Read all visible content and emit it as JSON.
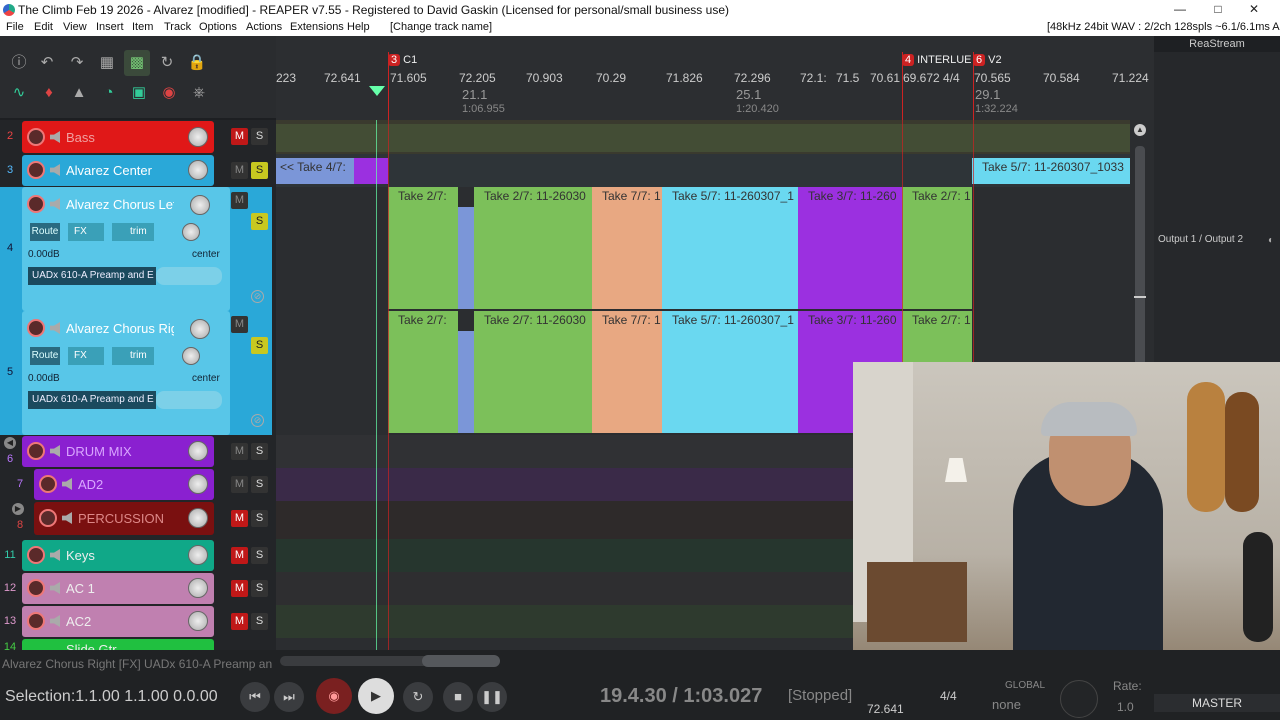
{
  "titlebar": {
    "title": "The Climb Feb 19 2026 - Alvarez [modified] - REAPER v7.55 - Registered to David Gaskin (Licensed for personal/small business use)",
    "min": "—",
    "max": "□",
    "close": "✕"
  },
  "menu": {
    "items": [
      "File",
      "Edit",
      "View",
      "Insert",
      "Item",
      "Track",
      "Options",
      "Actions",
      "Extensions",
      "Help"
    ],
    "change_track": "[Change track name]",
    "audio_status": "[48kHz 24bit WAV : 2/2ch 128spls ~6.1/6.1ms ASIO]"
  },
  "ruler": {
    "row1": [
      "223",
      "72.641",
      "71.605",
      "72.205",
      "70.903",
      "70.29",
      "71.826",
      "72.296",
      "72.1:",
      "71.5 ",
      "70.61",
      "69.672 4/4",
      "70.565",
      "70.584",
      "71.224"
    ],
    "measures": [
      "21.1",
      "25.1",
      "29.1"
    ],
    "times": [
      "1:06.955",
      "1:20.420",
      "1:32.224"
    ],
    "markers": [
      {
        "num": "3",
        "label": "C1"
      },
      {
        "num": "4",
        "label": "INTERLUE"
      },
      {
        "num": "6",
        "label": "V2"
      }
    ]
  },
  "rightpanel": {
    "title": "ReaStream",
    "output": "Output 1 / Output 2"
  },
  "tracks": [
    {
      "num": "2",
      "name": "Bass",
      "color": "#e01818",
      "text": "#f0a0a0"
    },
    {
      "num": "3",
      "name": "Alvarez Center",
      "color": "#2aa8d8",
      "text": "#ffffff"
    },
    {
      "num": "4",
      "name": "Alvarez Chorus Lef",
      "color": "#58c6e8",
      "text": "#ffffff",
      "route": "Route",
      "fx": "FX",
      "trim": "trim",
      "vol": "0.00dB",
      "pan": "center",
      "plugin": "UADx 610-A Preamp and E"
    },
    {
      "num": "5",
      "name": "Alvarez Chorus Rig",
      "color": "#58c6e8",
      "text": "#ffffff",
      "route": "Route",
      "fx": "FX",
      "trim": "trim",
      "vol": "0.00dB",
      "pan": "center",
      "plugin": "UADx 610-A Preamp and E"
    },
    {
      "num": "6",
      "name": "DRUM MIX",
      "color": "#8a20d0",
      "text": "#d9a6ff"
    },
    {
      "num": "7",
      "name": "AD2",
      "color": "#8a20d0",
      "text": "#d9a6ff"
    },
    {
      "num": "8",
      "name": "PERCUSSION",
      "color": "#7a1010",
      "text": "#d88"
    },
    {
      "num": "11",
      "name": "Keys",
      "color": "#10a888",
      "text": "#eee"
    },
    {
      "num": "12",
      "name": "AC 1",
      "color": "#c080b0",
      "text": "#eee"
    },
    {
      "num": "13",
      "name": "AC2",
      "color": "#c080b0",
      "text": "#eee"
    },
    {
      "num": "14",
      "name": "Slide Gtr",
      "color": "#20c040",
      "text": "#eee"
    }
  ],
  "mute_label": "M",
  "solo_label": "S",
  "items": {
    "center_left": "<< Take 4/7:",
    "center_right": "Take 5/7: 11-260307_1033",
    "lane": [
      "Take 2/7:",
      "Take 2/7: 11-26030",
      "Take 7/7: 1",
      "Take 5/7: 11-260307_1",
      "Take 3/7: 11-260",
      "Take 2/7: 1"
    ]
  },
  "status": {
    "hint": "Alvarez Chorus Right [FX] UADx 610-A Preamp an",
    "selection": "Selection:1.1.00 1.1.00 0.0.00",
    "position": "19.4.30 / 1:03.027",
    "state": "[Stopped]",
    "tempo": "72.641",
    "timesig": "4/4",
    "global_label": "GLOBAL",
    "global_value": "none",
    "rate_label": "Rate:",
    "rate_value": "1.0",
    "master": "MASTER"
  },
  "colors": {
    "green": "#7cc05a",
    "blue": "#7b96d8",
    "peach": "#e8a882",
    "cyan": "#6ad8f0",
    "purple": "#9b30e0"
  }
}
